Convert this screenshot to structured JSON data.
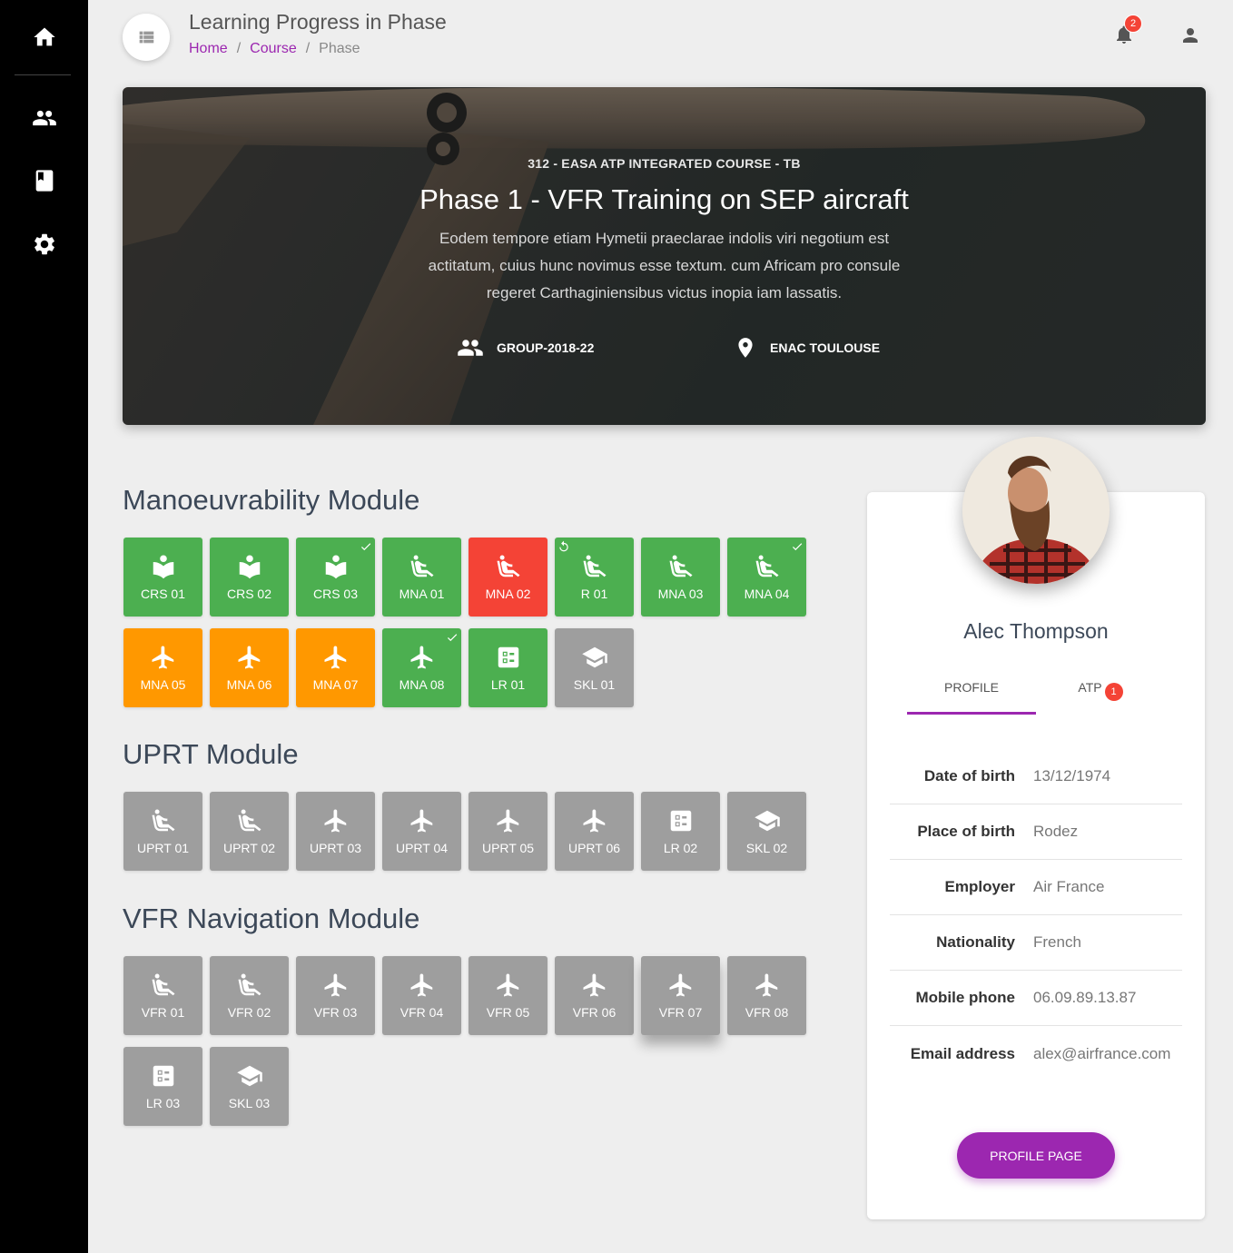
{
  "header": {
    "title": "Learning Progress in Phase",
    "breadcrumb": [
      "Home",
      "Course",
      "Phase"
    ],
    "notification_count": "2"
  },
  "hero": {
    "subtitle": "312 - EASA ATP INTEGRATED COURSE - TB",
    "title": "Phase 1 - VFR Training on SEP aircraft",
    "description": "Eodem tempore etiam Hymetii praeclarae indolis viri negotium est actitatum, cuius hunc novimus esse textum. cum Africam pro consule regeret Carthaginiensibus victus inopia iam lassatis.",
    "group": "GROUP-2018-22",
    "location": "ENAC TOULOUSE"
  },
  "modules": [
    {
      "title": "Manoeuvrability Module",
      "tiles": [
        {
          "label": "CRS 01",
          "color": "#4caf50",
          "icon": "book-icon"
        },
        {
          "label": "CRS 02",
          "color": "#4caf50",
          "icon": "book-icon"
        },
        {
          "label": "CRS 03",
          "color": "#4caf50",
          "icon": "book-icon",
          "mark": "check"
        },
        {
          "label": "MNA 01",
          "color": "#4caf50",
          "icon": "seat-icon"
        },
        {
          "label": "MNA 02",
          "color": "#f44336",
          "icon": "seat-icon"
        },
        {
          "label": "R 01",
          "color": "#4caf50",
          "icon": "seat-icon",
          "mark": "retry"
        },
        {
          "label": "MNA 03",
          "color": "#4caf50",
          "icon": "seat-icon"
        },
        {
          "label": "MNA 04",
          "color": "#4caf50",
          "icon": "seat-icon",
          "mark": "check"
        },
        {
          "label": "MNA 05",
          "color": "#ff9800",
          "icon": "plane-icon"
        },
        {
          "label": "MNA 06",
          "color": "#ff9800",
          "icon": "plane-icon"
        },
        {
          "label": "MNA 07",
          "color": "#ff9800",
          "icon": "plane-icon"
        },
        {
          "label": "MNA 08",
          "color": "#4caf50",
          "icon": "plane-icon",
          "mark": "check"
        },
        {
          "label": "LR 01",
          "color": "#4caf50",
          "icon": "checklist-icon"
        },
        {
          "label": "SKL 01",
          "color": "#9e9e9e",
          "icon": "school-icon"
        }
      ]
    },
    {
      "title": "UPRT Module",
      "tiles": [
        {
          "label": "UPRT 01",
          "color": "#9e9e9e",
          "icon": "seat-icon"
        },
        {
          "label": "UPRT 02",
          "color": "#9e9e9e",
          "icon": "seat-icon"
        },
        {
          "label": "UPRT 03",
          "color": "#9e9e9e",
          "icon": "plane-icon"
        },
        {
          "label": "UPRT 04",
          "color": "#9e9e9e",
          "icon": "plane-icon"
        },
        {
          "label": "UPRT 05",
          "color": "#9e9e9e",
          "icon": "plane-icon"
        },
        {
          "label": "UPRT 06",
          "color": "#9e9e9e",
          "icon": "plane-icon"
        },
        {
          "label": "LR 02",
          "color": "#9e9e9e",
          "icon": "checklist-icon"
        },
        {
          "label": "SKL 02",
          "color": "#9e9e9e",
          "icon": "school-icon"
        }
      ]
    },
    {
      "title": "VFR Navigation Module",
      "tiles": [
        {
          "label": "VFR 01",
          "color": "#9e9e9e",
          "icon": "seat-icon"
        },
        {
          "label": "VFR 02",
          "color": "#9e9e9e",
          "icon": "seat-icon"
        },
        {
          "label": "VFR 03",
          "color": "#9e9e9e",
          "icon": "plane-icon"
        },
        {
          "label": "VFR 04",
          "color": "#9e9e9e",
          "icon": "plane-icon"
        },
        {
          "label": "VFR 05",
          "color": "#9e9e9e",
          "icon": "plane-icon"
        },
        {
          "label": "VFR 06",
          "color": "#9e9e9e",
          "icon": "plane-icon"
        },
        {
          "label": "VFR 07",
          "color": "#9e9e9e",
          "icon": "plane-icon",
          "raised": true
        },
        {
          "label": "VFR 08",
          "color": "#9e9e9e",
          "icon": "plane-icon"
        },
        {
          "label": "LR 03",
          "color": "#9e9e9e",
          "icon": "checklist-icon"
        },
        {
          "label": "SKL 03",
          "color": "#9e9e9e",
          "icon": "school-icon"
        }
      ]
    }
  ],
  "profile": {
    "name": "Alec Thompson",
    "tabs": {
      "profile": "PROFILE",
      "atp": "ATP",
      "atp_badge": "1"
    },
    "fields": [
      {
        "key": "Date of birth",
        "value": "13/12/1974"
      },
      {
        "key": "Place of birth",
        "value": "Rodez"
      },
      {
        "key": "Employer",
        "value": "Air France"
      },
      {
        "key": "Nationality",
        "value": "French"
      },
      {
        "key": "Mobile phone",
        "value": "06.09.89.13.87"
      },
      {
        "key": "Email address",
        "value": "alex@airfrance.com"
      }
    ],
    "button": "PROFILE PAGE"
  }
}
